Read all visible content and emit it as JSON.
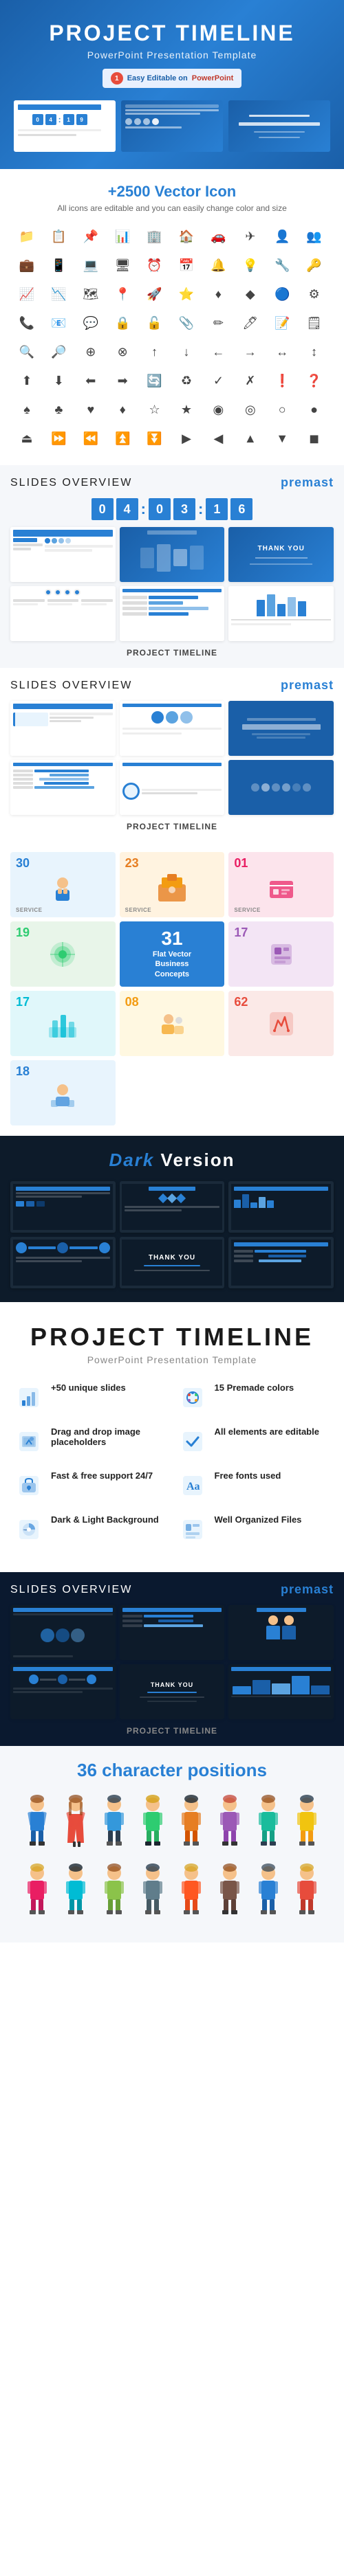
{
  "hero": {
    "title": "PROJECT TIMELINE",
    "subtitle": "PowerPoint Presentation Template",
    "badge_icon": "1",
    "badge_text1": "Easy Editable on",
    "badge_text2": "PowerPoint",
    "slides": [
      {
        "label": "slide1"
      },
      {
        "label": "slide2"
      },
      {
        "label": "slide3"
      }
    ]
  },
  "icons_section": {
    "title_prefix": "+2500",
    "title_suffix": " Vector Icon",
    "subtitle": "All icons are editable and you can easily change color and size",
    "icons": [
      "📁",
      "📋",
      "📌",
      "📊",
      "🏢",
      "🏠",
      "🚗",
      "✈",
      "👤",
      "👥",
      "💼",
      "📱",
      "💻",
      "🖥",
      "⏰",
      "📅",
      "🔔",
      "💡",
      "🔧",
      "🔑",
      "📈",
      "📉",
      "🗺",
      "📍",
      "🚀",
      "⭐",
      "♦",
      "◆",
      "🔵",
      "⚙",
      "📞",
      "📧",
      "💬",
      "🔒",
      "🔓",
      "📎",
      "✏",
      "🖊",
      "📝",
      "🗒",
      "🔍",
      "🔎",
      "⊕",
      "⊗",
      "↑",
      "↓",
      "←",
      "→",
      "↔",
      "↕",
      "⬆",
      "⬇",
      "⬅",
      "➡",
      "🔄",
      "♻",
      "✓",
      "✗",
      "❗",
      "❓",
      "♠",
      "♣",
      "♥",
      "♦",
      "☆",
      "★",
      "◉",
      "◎",
      "○",
      "●",
      "⏏",
      "⏩",
      "⏪",
      "⏫",
      "⏬",
      "▶",
      "◀",
      "▲",
      "▼",
      "◼"
    ]
  },
  "slides_overview_1": {
    "title_bold": "SLIDES",
    "title_light": " OVERVIEW",
    "logo": "premast",
    "label": "PROJECT TIMELINE",
    "counter": [
      "0",
      "4",
      "1",
      "0",
      "3",
      "1",
      "6"
    ],
    "counter_label": "04 : 03 : 16"
  },
  "slides_overview_2": {
    "title_bold": "SLIDES",
    "title_light": " OVERVIEW",
    "logo": "premast",
    "label": "PROJECT TIMELINE"
  },
  "flat_vector": {
    "title": "31",
    "subtitle_line1": "Flat Vector",
    "subtitle_line2": "Business",
    "subtitle_line3": "Concepts",
    "numbers": [
      {
        "num": "30",
        "label": "SERVICE"
      },
      {
        "num": "23",
        "label": "SERVICE"
      },
      {
        "num": "01",
        "label": "SERVICE"
      },
      {
        "num": "19",
        "label": ""
      },
      {
        "num": "31",
        "label": ""
      },
      {
        "num": "17",
        "label": ""
      },
      {
        "num": "17",
        "label": ""
      },
      {
        "num": "08",
        "label": ""
      },
      {
        "num": "62",
        "label": ""
      },
      {
        "num": "18",
        "label": ""
      }
    ]
  },
  "dark_version": {
    "title_dark": "Dark",
    "title_rest": " Version"
  },
  "project_timeline_section": {
    "title": "PROJECT TIMELINE",
    "subtitle": "PowerPoint Presentation Template",
    "features": [
      {
        "icon": "📊",
        "title": "+50 unique slides",
        "desc": ""
      },
      {
        "icon": "🎨",
        "title": "15 Premade colors",
        "desc": ""
      },
      {
        "icon": "🖼",
        "title": "Drag and drop image placeholders",
        "desc": ""
      },
      {
        "icon": "✏",
        "title": "All elements are editable",
        "desc": ""
      },
      {
        "icon": "💬",
        "title": "Fast & free support 24/7",
        "desc": ""
      },
      {
        "icon": "🔤",
        "title": "Free fonts used",
        "desc": ""
      },
      {
        "icon": "🌓",
        "title": "Dark & Light Background",
        "desc": ""
      },
      {
        "icon": "📁",
        "title": "Well Organized Files",
        "desc": ""
      }
    ]
  },
  "slides_overview_3": {
    "title_bold": "SLIDES",
    "title_light": " OVERVIEW",
    "logo": "premast",
    "label": "PROJECT TIMELINE"
  },
  "characters_section": {
    "title_prefix": "36",
    "title_suffix": " character positions",
    "colors": [
      "#2980d4",
      "#e74c3c",
      "#2ecc71",
      "#f39c12",
      "#9b59b6",
      "#1abc9c",
      "#e67e22",
      "#3498db",
      "#2c3e50",
      "#e91e63",
      "#00bcd4",
      "#8bc34a"
    ],
    "count": 12
  }
}
